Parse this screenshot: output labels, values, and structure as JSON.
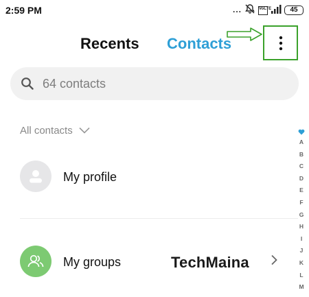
{
  "status_bar": {
    "time": "2:59 PM",
    "dots": "...",
    "volte": "VoLTE",
    "battery": "45",
    "icons": [
      "alarm-off-icon",
      "signal-icon",
      "battery-icon"
    ]
  },
  "tabs": [
    {
      "label": "Recents",
      "active": false
    },
    {
      "label": "Contacts",
      "active": true
    }
  ],
  "colors": {
    "accent": "#2e9fd6",
    "annotation": "#3aa12a",
    "groups_avatar": "#7dca72",
    "profile_avatar": "#e6e6e8"
  },
  "search": {
    "placeholder": "64 contacts",
    "value": ""
  },
  "filter": {
    "label": "All contacts"
  },
  "alphabet_index": [
    "A",
    "B",
    "C",
    "D",
    "E",
    "F",
    "G",
    "H",
    "I",
    "J",
    "K",
    "L",
    "M"
  ],
  "list": {
    "profile_label": "My profile",
    "groups_label": "My groups"
  },
  "watermark": "TechMaina"
}
